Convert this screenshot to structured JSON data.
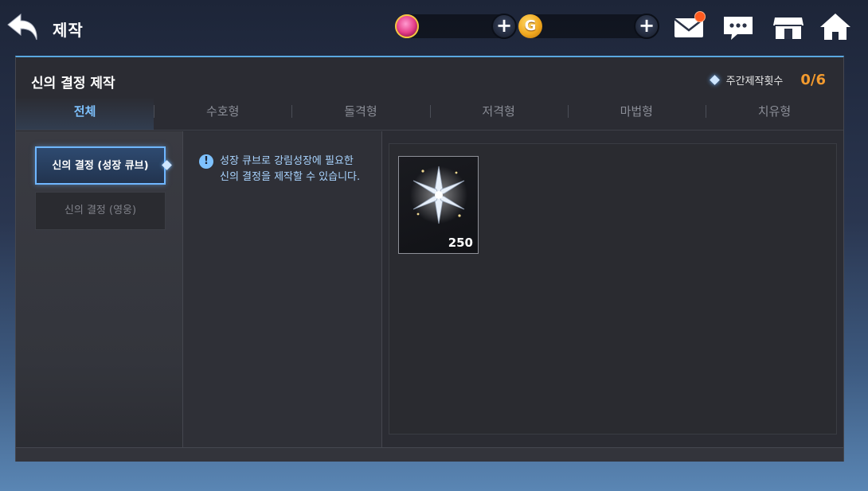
{
  "header": {
    "title": "제작",
    "back_icon": "back-arrow-icon"
  },
  "currencies": [
    {
      "icon": "gem-icon",
      "value": ""
    },
    {
      "icon": "gold-icon",
      "symbol": "G",
      "value": ""
    }
  ],
  "top_icons": [
    "mail-icon",
    "chat-icon",
    "shop-icon",
    "home-icon"
  ],
  "mail_badge_color": "#ff5a1e",
  "panel": {
    "title": "신의 결정 제작",
    "weekly_label": "주간제작횟수",
    "weekly_count": "0/6",
    "accent_color": "#5aa8e0",
    "tabs": [
      "전체",
      "수호형",
      "돌격형",
      "저격형",
      "마법형",
      "치유형"
    ],
    "active_tab": "전체"
  },
  "categories": [
    {
      "label": "신의 결정 (성장 큐브)",
      "active": true
    },
    {
      "label": "신의 결정 (영웅)",
      "active": false
    }
  ],
  "info": {
    "line1": "성장 큐브로 강림성장에 필요한",
    "line2": "신의 결정을 제작할 수 있습니다."
  },
  "items": [
    {
      "icon": "crystal-star-icon",
      "quantity": "250"
    }
  ]
}
